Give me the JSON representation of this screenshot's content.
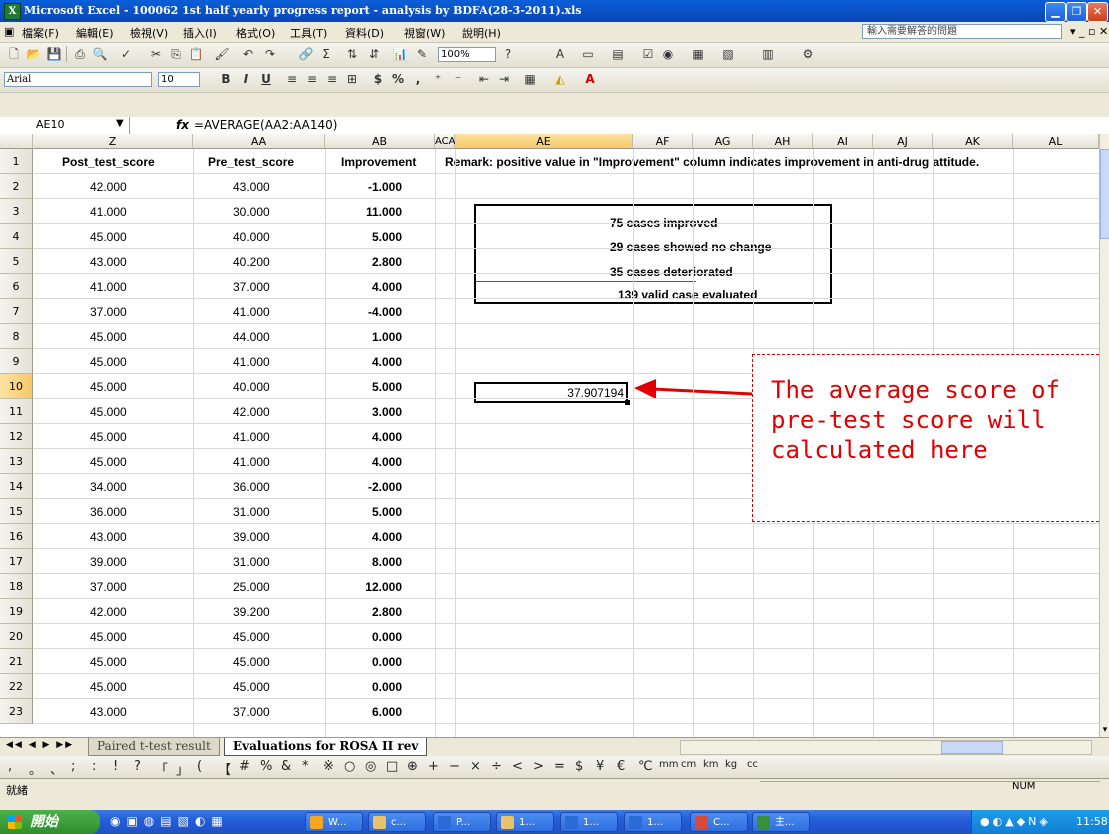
{
  "window": {
    "title": "Microsoft Excel - 100062 1st half yearly progress report - analysis by BDFA(28-3-2011).xls"
  },
  "menu": {
    "items": [
      "檔案(F)",
      "編輯(E)",
      "檢視(V)",
      "插入(I)",
      "格式(O)",
      "工具(T)",
      "資料(D)",
      "視窗(W)",
      "說明(H)"
    ],
    "help_placeholder": "輸入需要解答的問題"
  },
  "toolbar": {
    "zoom": "100%",
    "font": "Arial",
    "font_size": "10",
    "bold": "B",
    "italic": "I",
    "underline": "U",
    "currency": "$",
    "percent": "%",
    "comma": ","
  },
  "formula_bar": {
    "name_box": "AE10",
    "fx": "fx",
    "formula": "=AVERAGE(AA2:AA140)"
  },
  "columns": [
    "Z",
    "AA",
    "AB",
    "ACA",
    "AE",
    "AF",
    "AG",
    "AH",
    "AI",
    "AJ",
    "AK",
    "AL"
  ],
  "headers": {
    "z": "Post_test_score",
    "aa": "Pre_test_score",
    "ab": "Improvement",
    "remark": "Remark: positive value in \"Improvement\" column indicates improvement in anti-drug attitude."
  },
  "rows": [
    {
      "n": "2",
      "z": "42.000",
      "aa": "43.000",
      "ab": "-1.000"
    },
    {
      "n": "3",
      "z": "41.000",
      "aa": "30.000",
      "ab": "11.000"
    },
    {
      "n": "4",
      "z": "45.000",
      "aa": "40.000",
      "ab": "5.000"
    },
    {
      "n": "5",
      "z": "43.000",
      "aa": "40.200",
      "ab": "2.800"
    },
    {
      "n": "6",
      "z": "41.000",
      "aa": "37.000",
      "ab": "4.000"
    },
    {
      "n": "7",
      "z": "37.000",
      "aa": "41.000",
      "ab": "-4.000"
    },
    {
      "n": "8",
      "z": "45.000",
      "aa": "44.000",
      "ab": "1.000"
    },
    {
      "n": "9",
      "z": "45.000",
      "aa": "41.000",
      "ab": "4.000"
    },
    {
      "n": "10",
      "z": "45.000",
      "aa": "40.000",
      "ab": "5.000"
    },
    {
      "n": "11",
      "z": "45.000",
      "aa": "42.000",
      "ab": "3.000"
    },
    {
      "n": "12",
      "z": "45.000",
      "aa": "41.000",
      "ab": "4.000"
    },
    {
      "n": "13",
      "z": "45.000",
      "aa": "41.000",
      "ab": "4.000"
    },
    {
      "n": "14",
      "z": "34.000",
      "aa": "36.000",
      "ab": "-2.000"
    },
    {
      "n": "15",
      "z": "36.000",
      "aa": "31.000",
      "ab": "5.000"
    },
    {
      "n": "16",
      "z": "43.000",
      "aa": "39.000",
      "ab": "4.000"
    },
    {
      "n": "17",
      "z": "39.000",
      "aa": "31.000",
      "ab": "8.000"
    },
    {
      "n": "18",
      "z": "37.000",
      "aa": "25.000",
      "ab": "12.000"
    },
    {
      "n": "19",
      "z": "42.000",
      "aa": "39.200",
      "ab": "2.800"
    },
    {
      "n": "20",
      "z": "45.000",
      "aa": "45.000",
      "ab": "0.000"
    },
    {
      "n": "21",
      "z": "45.000",
      "aa": "45.000",
      "ab": "0.000"
    },
    {
      "n": "22",
      "z": "45.000",
      "aa": "45.000",
      "ab": "0.000"
    },
    {
      "n": "23",
      "z": "43.000",
      "aa": "37.000",
      "ab": "6.000"
    }
  ],
  "summary": [
    "75 cases improved",
    "29 cases showed no change",
    "35 cases deteriorated",
    "139 valid case evaluated"
  ],
  "result_cell": "37.907194",
  "annotation": {
    "line1": "The average score of",
    "line2": "pre-test score will",
    "line3": "calculated here"
  },
  "sheet_tabs": [
    "Paired t-test result",
    "Evaluations for ROSA II rev"
  ],
  "symbols": [
    ",",
    "。",
    "、",
    ";",
    ":",
    "!",
    "?",
    "「",
    "」",
    "(",
    "【",
    "#",
    "%",
    "&",
    "*",
    "※",
    "○",
    "◎",
    "□",
    "⊕",
    "+",
    "−",
    "×",
    "÷",
    "<",
    ">",
    "=",
    "$",
    "¥",
    "€",
    "℃",
    "mm",
    "cm",
    "km",
    "kg",
    "cc"
  ],
  "status": {
    "ready": "就緒",
    "num": "NUM"
  },
  "taskbar": {
    "start": "開始",
    "tasks": [
      "W...",
      "c...",
      "P...",
      "1...",
      "1...",
      "1...",
      "C...",
      "主..."
    ],
    "clock": "11:58"
  },
  "colors": {
    "accent_title": "#0b4fc4",
    "annotation": "#e00000",
    "selection_header": "#f7c86a"
  }
}
